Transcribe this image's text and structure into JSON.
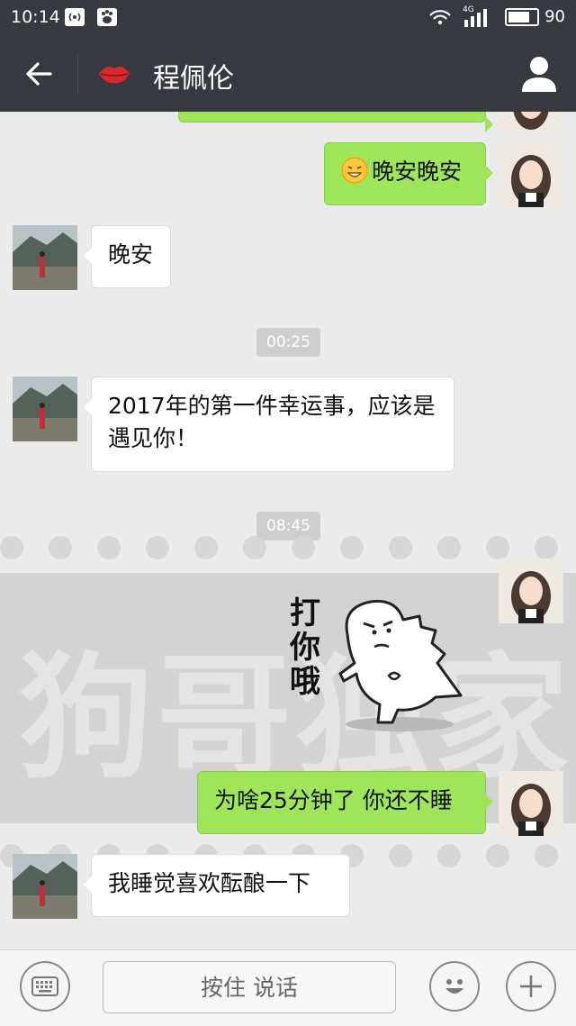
{
  "status_bar": {
    "time": "10:14",
    "network_label": "4G",
    "battery_level": "90",
    "battery_fraction": 0.9
  },
  "header": {
    "title": "程佩伦",
    "back_icon": "arrow-left-icon",
    "contact_emoji": "lips-icon",
    "profile_icon": "person-icon"
  },
  "watermark": {
    "text": "狗哥独家"
  },
  "messages": [
    {
      "id": "m1",
      "side": "out",
      "text": "晚安晚安",
      "emoji": "grin-emoji"
    },
    {
      "id": "m2",
      "side": "in",
      "text": "晚安"
    },
    {
      "id": "t1",
      "type": "timestamp",
      "text": "00:25"
    },
    {
      "id": "m3",
      "side": "in",
      "text": "2017年的第一件幸运事，应该是遇见你！"
    },
    {
      "id": "t2",
      "type": "timestamp",
      "text": "08:45"
    },
    {
      "id": "m4",
      "side": "out",
      "type": "sticker",
      "text": "打你哦"
    },
    {
      "id": "m5",
      "side": "out",
      "text": "为啥25分钟了 你还不睡"
    },
    {
      "id": "m6",
      "side": "in",
      "text": "我睡觉喜欢酝酿一下"
    }
  ],
  "input_bar": {
    "voice_label": "按住 说话",
    "keyboard_icon": "keyboard-icon",
    "emoji_icon": "smiley-icon",
    "plus_icon": "plus-icon"
  },
  "colors": {
    "header_bg": "#363a40",
    "chat_bg": "#ebebeb",
    "out_bubble": "#9fe55a",
    "in_bubble": "#ffffff"
  }
}
